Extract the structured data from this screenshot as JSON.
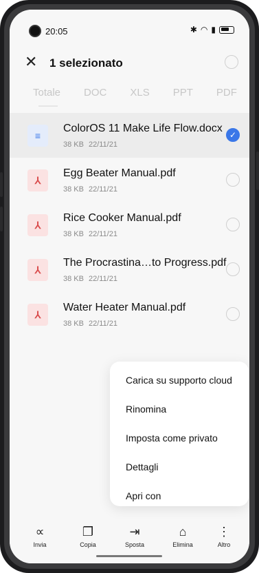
{
  "status_bar": {
    "time": "20:05",
    "icons": [
      "bluetooth-icon",
      "wifi-icon",
      "signal-icon",
      "battery-icon"
    ]
  },
  "header": {
    "title": "1 selezionato"
  },
  "tabs": [
    {
      "label": "Totale",
      "active": true
    },
    {
      "label": "DOC"
    },
    {
      "label": "XLS"
    },
    {
      "label": "PPT"
    },
    {
      "label": "PDF"
    }
  ],
  "files": [
    {
      "name": "ColorOS 11 Make Life Flow.docx",
      "size": "38 KB",
      "date": "22/11/21",
      "type": "doc",
      "selected": true
    },
    {
      "name": "Egg Beater Manual.pdf",
      "size": "38 KB",
      "date": "22/11/21",
      "type": "pdf",
      "selected": false
    },
    {
      "name": "Rice Cooker Manual.pdf",
      "size": "38 KB",
      "date": "22/11/21",
      "type": "pdf",
      "selected": false
    },
    {
      "name": "The Procrastina…to Progress.pdf",
      "size": "38 KB",
      "date": "22/11/21",
      "type": "pdf",
      "selected": false
    },
    {
      "name": "Water Heater Manual.pdf",
      "size": "38 KB",
      "date": "22/11/21",
      "type": "pdf",
      "selected": false
    }
  ],
  "menu": {
    "items": [
      "Carica su supporto cloud",
      "Rinomina",
      "Imposta come privato",
      "Dettagli",
      "Apri con"
    ]
  },
  "actions": [
    {
      "label": "Invia",
      "icon": "share-icon"
    },
    {
      "label": "Copia",
      "icon": "copy-icon"
    },
    {
      "label": "Sposta",
      "icon": "move-icon"
    },
    {
      "label": "Elimina",
      "icon": "trash-icon"
    },
    {
      "label": "Altro",
      "icon": "more-icon"
    }
  ],
  "colors": {
    "accent": "#3a77e8",
    "pdf": "#d94a4a"
  }
}
